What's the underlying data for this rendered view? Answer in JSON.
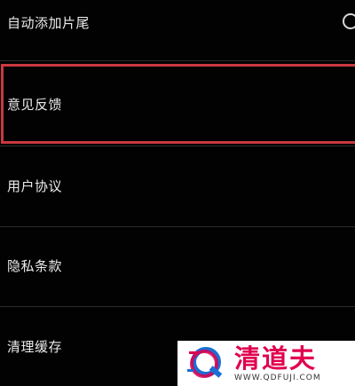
{
  "settings": {
    "items": [
      {
        "label": "自动添加片尾",
        "has_toggle": true,
        "toggle_on": false
      },
      {
        "label": "意见反馈",
        "highlighted": true
      },
      {
        "label": "用户协议"
      },
      {
        "label": "隐私条款"
      },
      {
        "label": "清理缓存"
      }
    ]
  },
  "highlight_color": "#c9393f",
  "watermark": {
    "title": "清道夫",
    "url": "WWW.QDFUJI.COM",
    "icon": "q-logo-icon",
    "colors": {
      "brand": "#e0004f",
      "accent": "#1a6fd6"
    }
  }
}
